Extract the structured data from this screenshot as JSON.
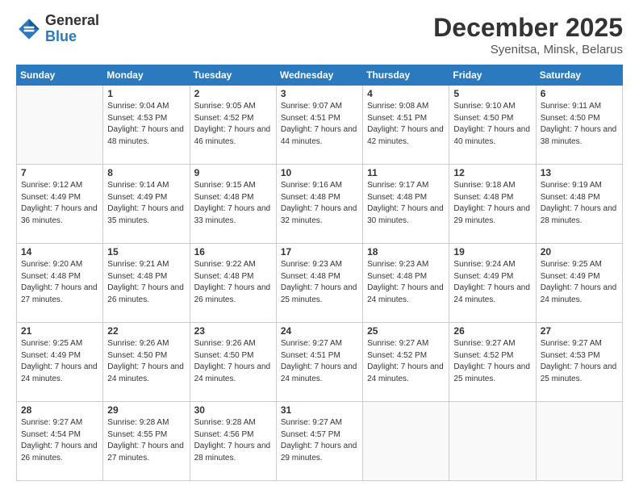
{
  "header": {
    "logo_general": "General",
    "logo_blue": "Blue",
    "month_title": "December 2025",
    "subtitle": "Syenitsa, Minsk, Belarus"
  },
  "weekdays": [
    "Sunday",
    "Monday",
    "Tuesday",
    "Wednesday",
    "Thursday",
    "Friday",
    "Saturday"
  ],
  "weeks": [
    [
      {
        "day": "",
        "sunrise": "",
        "sunset": "",
        "daylight": ""
      },
      {
        "day": "1",
        "sunrise": "Sunrise: 9:04 AM",
        "sunset": "Sunset: 4:53 PM",
        "daylight": "Daylight: 7 hours and 48 minutes."
      },
      {
        "day": "2",
        "sunrise": "Sunrise: 9:05 AM",
        "sunset": "Sunset: 4:52 PM",
        "daylight": "Daylight: 7 hours and 46 minutes."
      },
      {
        "day": "3",
        "sunrise": "Sunrise: 9:07 AM",
        "sunset": "Sunset: 4:51 PM",
        "daylight": "Daylight: 7 hours and 44 minutes."
      },
      {
        "day": "4",
        "sunrise": "Sunrise: 9:08 AM",
        "sunset": "Sunset: 4:51 PM",
        "daylight": "Daylight: 7 hours and 42 minutes."
      },
      {
        "day": "5",
        "sunrise": "Sunrise: 9:10 AM",
        "sunset": "Sunset: 4:50 PM",
        "daylight": "Daylight: 7 hours and 40 minutes."
      },
      {
        "day": "6",
        "sunrise": "Sunrise: 9:11 AM",
        "sunset": "Sunset: 4:50 PM",
        "daylight": "Daylight: 7 hours and 38 minutes."
      }
    ],
    [
      {
        "day": "7",
        "sunrise": "Sunrise: 9:12 AM",
        "sunset": "Sunset: 4:49 PM",
        "daylight": "Daylight: 7 hours and 36 minutes."
      },
      {
        "day": "8",
        "sunrise": "Sunrise: 9:14 AM",
        "sunset": "Sunset: 4:49 PM",
        "daylight": "Daylight: 7 hours and 35 minutes."
      },
      {
        "day": "9",
        "sunrise": "Sunrise: 9:15 AM",
        "sunset": "Sunset: 4:48 PM",
        "daylight": "Daylight: 7 hours and 33 minutes."
      },
      {
        "day": "10",
        "sunrise": "Sunrise: 9:16 AM",
        "sunset": "Sunset: 4:48 PM",
        "daylight": "Daylight: 7 hours and 32 minutes."
      },
      {
        "day": "11",
        "sunrise": "Sunrise: 9:17 AM",
        "sunset": "Sunset: 4:48 PM",
        "daylight": "Daylight: 7 hours and 30 minutes."
      },
      {
        "day": "12",
        "sunrise": "Sunrise: 9:18 AM",
        "sunset": "Sunset: 4:48 PM",
        "daylight": "Daylight: 7 hours and 29 minutes."
      },
      {
        "day": "13",
        "sunrise": "Sunrise: 9:19 AM",
        "sunset": "Sunset: 4:48 PM",
        "daylight": "Daylight: 7 hours and 28 minutes."
      }
    ],
    [
      {
        "day": "14",
        "sunrise": "Sunrise: 9:20 AM",
        "sunset": "Sunset: 4:48 PM",
        "daylight": "Daylight: 7 hours and 27 minutes."
      },
      {
        "day": "15",
        "sunrise": "Sunrise: 9:21 AM",
        "sunset": "Sunset: 4:48 PM",
        "daylight": "Daylight: 7 hours and 26 minutes."
      },
      {
        "day": "16",
        "sunrise": "Sunrise: 9:22 AM",
        "sunset": "Sunset: 4:48 PM",
        "daylight": "Daylight: 7 hours and 26 minutes."
      },
      {
        "day": "17",
        "sunrise": "Sunrise: 9:23 AM",
        "sunset": "Sunset: 4:48 PM",
        "daylight": "Daylight: 7 hours and 25 minutes."
      },
      {
        "day": "18",
        "sunrise": "Sunrise: 9:23 AM",
        "sunset": "Sunset: 4:48 PM",
        "daylight": "Daylight: 7 hours and 24 minutes."
      },
      {
        "day": "19",
        "sunrise": "Sunrise: 9:24 AM",
        "sunset": "Sunset: 4:49 PM",
        "daylight": "Daylight: 7 hours and 24 minutes."
      },
      {
        "day": "20",
        "sunrise": "Sunrise: 9:25 AM",
        "sunset": "Sunset: 4:49 PM",
        "daylight": "Daylight: 7 hours and 24 minutes."
      }
    ],
    [
      {
        "day": "21",
        "sunrise": "Sunrise: 9:25 AM",
        "sunset": "Sunset: 4:49 PM",
        "daylight": "Daylight: 7 hours and 24 minutes."
      },
      {
        "day": "22",
        "sunrise": "Sunrise: 9:26 AM",
        "sunset": "Sunset: 4:50 PM",
        "daylight": "Daylight: 7 hours and 24 minutes."
      },
      {
        "day": "23",
        "sunrise": "Sunrise: 9:26 AM",
        "sunset": "Sunset: 4:50 PM",
        "daylight": "Daylight: 7 hours and 24 minutes."
      },
      {
        "day": "24",
        "sunrise": "Sunrise: 9:27 AM",
        "sunset": "Sunset: 4:51 PM",
        "daylight": "Daylight: 7 hours and 24 minutes."
      },
      {
        "day": "25",
        "sunrise": "Sunrise: 9:27 AM",
        "sunset": "Sunset: 4:52 PM",
        "daylight": "Daylight: 7 hours and 24 minutes."
      },
      {
        "day": "26",
        "sunrise": "Sunrise: 9:27 AM",
        "sunset": "Sunset: 4:52 PM",
        "daylight": "Daylight: 7 hours and 25 minutes."
      },
      {
        "day": "27",
        "sunrise": "Sunrise: 9:27 AM",
        "sunset": "Sunset: 4:53 PM",
        "daylight": "Daylight: 7 hours and 25 minutes."
      }
    ],
    [
      {
        "day": "28",
        "sunrise": "Sunrise: 9:27 AM",
        "sunset": "Sunset: 4:54 PM",
        "daylight": "Daylight: 7 hours and 26 minutes."
      },
      {
        "day": "29",
        "sunrise": "Sunrise: 9:28 AM",
        "sunset": "Sunset: 4:55 PM",
        "daylight": "Daylight: 7 hours and 27 minutes."
      },
      {
        "day": "30",
        "sunrise": "Sunrise: 9:28 AM",
        "sunset": "Sunset: 4:56 PM",
        "daylight": "Daylight: 7 hours and 28 minutes."
      },
      {
        "day": "31",
        "sunrise": "Sunrise: 9:27 AM",
        "sunset": "Sunset: 4:57 PM",
        "daylight": "Daylight: 7 hours and 29 minutes."
      },
      {
        "day": "",
        "sunrise": "",
        "sunset": "",
        "daylight": ""
      },
      {
        "day": "",
        "sunrise": "",
        "sunset": "",
        "daylight": ""
      },
      {
        "day": "",
        "sunrise": "",
        "sunset": "",
        "daylight": ""
      }
    ]
  ]
}
